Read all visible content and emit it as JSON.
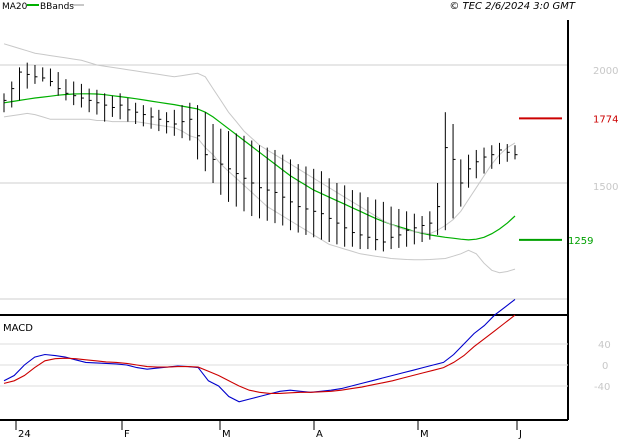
{
  "header": {
    "legend": [
      {
        "label": "MA20",
        "color": "#00b000"
      },
      {
        "label": "BBands",
        "color": "#c8c8c8"
      }
    ],
    "stamp": "© TEC 2/6/2024 3:0 GMT"
  },
  "chart_data": [
    {
      "type": "ohlc",
      "y_ticks": [
        "2000",
        "1500"
      ],
      "x_ticks": [
        "24",
        "F",
        "M",
        "A",
        "M",
        "J"
      ],
      "levels": [
        {
          "label": "1774",
          "value": 1774,
          "color": "#cc0000"
        },
        {
          "label": "1259",
          "value": 1259,
          "color": "#00a000"
        }
      ],
      "series": [
        {
          "name": "MA20",
          "color": "#00b000",
          "values": [
            1840,
            1845,
            1850,
            1855,
            1860,
            1864,
            1868,
            1872,
            1875,
            1877,
            1878,
            1878,
            1877,
            1874,
            1870,
            1866,
            1862,
            1857,
            1852,
            1847,
            1842,
            1837,
            1832,
            1826,
            1820,
            1814,
            1800,
            1780,
            1755,
            1730,
            1705,
            1680,
            1655,
            1630,
            1605,
            1580,
            1555,
            1530,
            1510,
            1490,
            1470,
            1455,
            1440,
            1425,
            1410,
            1395,
            1380,
            1365,
            1350,
            1337,
            1325,
            1315,
            1305,
            1295,
            1287,
            1280,
            1275,
            1270,
            1266,
            1262,
            1259,
            1262,
            1270,
            1285,
            1305,
            1330,
            1360
          ]
        },
        {
          "name": "BBands upper",
          "color": "#c8c8c8",
          "values": [
            2090,
            2080,
            2070,
            2060,
            2050,
            2045,
            2040,
            2035,
            2030,
            2025,
            2020,
            2010,
            2000,
            1995,
            1990,
            1985,
            1980,
            1975,
            1970,
            1965,
            1960,
            1955,
            1950,
            1955,
            1960,
            1965,
            1950,
            1900,
            1850,
            1800,
            1760,
            1720,
            1690,
            1660,
            1640,
            1620,
            1600,
            1580,
            1560,
            1540,
            1520,
            1500,
            1480,
            1460,
            1440,
            1420,
            1400,
            1380,
            1360,
            1340,
            1325,
            1310,
            1300,
            1295,
            1290,
            1285,
            1300,
            1320,
            1345,
            1380,
            1430,
            1480,
            1530,
            1580,
            1620,
            1650,
            1670
          ]
        },
        {
          "name": "BBands lower",
          "color": "#c8c8c8",
          "values": [
            1780,
            1785,
            1790,
            1795,
            1790,
            1780,
            1770,
            1770,
            1770,
            1770,
            1770,
            1770,
            1765,
            1765,
            1760,
            1760,
            1760,
            1760,
            1755,
            1750,
            1745,
            1740,
            1735,
            1720,
            1700,
            1690,
            1650,
            1620,
            1580,
            1550,
            1520,
            1490,
            1460,
            1430,
            1400,
            1380,
            1360,
            1340,
            1320,
            1300,
            1280,
            1260,
            1240,
            1230,
            1220,
            1210,
            1200,
            1195,
            1190,
            1185,
            1180,
            1178,
            1176,
            1175,
            1175,
            1176,
            1178,
            1180,
            1190,
            1200,
            1215,
            1200,
            1160,
            1130,
            1120,
            1125,
            1135
          ]
        }
      ],
      "candles": {
        "high": [
          1880,
          1930,
          1990,
          2010,
          2000,
          1990,
          1985,
          1970,
          1940,
          1930,
          1920,
          1900,
          1895,
          1880,
          1870,
          1880,
          1860,
          1840,
          1830,
          1820,
          1810,
          1800,
          1810,
          1830,
          1840,
          1830,
          1800,
          1750,
          1730,
          1720,
          1710,
          1700,
          1680,
          1660,
          1650,
          1640,
          1620,
          1600,
          1580,
          1570,
          1560,
          1550,
          1520,
          1500,
          1490,
          1470,
          1460,
          1440,
          1430,
          1420,
          1400,
          1390,
          1380,
          1370,
          1360,
          1380,
          1500,
          1800,
          1750,
          1600,
          1620,
          1640,
          1650,
          1660,
          1670,
          1665,
          1660
        ],
        "low": [
          1800,
          1820,
          1850,
          1900,
          1920,
          1930,
          1910,
          1870,
          1850,
          1830,
          1820,
          1800,
          1790,
          1760,
          1780,
          1770,
          1760,
          1750,
          1740,
          1730,
          1720,
          1710,
          1700,
          1690,
          1680,
          1600,
          1550,
          1500,
          1450,
          1420,
          1400,
          1380,
          1360,
          1350,
          1340,
          1330,
          1320,
          1300,
          1290,
          1280,
          1270,
          1260,
          1250,
          1240,
          1230,
          1230,
          1220,
          1220,
          1215,
          1210,
          1220,
          1225,
          1230,
          1240,
          1250,
          1260,
          1280,
          1300,
          1350,
          1400,
          1480,
          1520,
          1540,
          1560,
          1580,
          1590,
          1600
        ],
        "close": [
          1850,
          1900,
          1970,
          1960,
          1950,
          1945,
          1930,
          1900,
          1880,
          1870,
          1860,
          1850,
          1840,
          1830,
          1820,
          1830,
          1810,
          1800,
          1790,
          1780,
          1770,
          1760,
          1750,
          1760,
          1770,
          1700,
          1620,
          1600,
          1580,
          1560,
          1540,
          1520,
          1500,
          1480,
          1470,
          1460,
          1440,
          1420,
          1400,
          1390,
          1380,
          1370,
          1350,
          1330,
          1310,
          1290,
          1280,
          1270,
          1260,
          1250,
          1270,
          1280,
          1300,
          1310,
          1320,
          1330,
          1400,
          1650,
          1600,
          1500,
          1560,
          1590,
          1610,
          1620,
          1640,
          1630,
          1620
        ]
      }
    },
    {
      "type": "line",
      "title": "MACD",
      "y_ticks": [
        "40",
        "0",
        "-40"
      ],
      "series": [
        {
          "name": "MACD",
          "color": "#0000cc",
          "values": [
            -30,
            -20,
            0,
            15,
            20,
            18,
            15,
            10,
            5,
            4,
            3,
            2,
            0,
            -5,
            -8,
            -6,
            -4,
            -2,
            -3,
            -5,
            -30,
            -40,
            -60,
            -70,
            -65,
            -60,
            -55,
            -50,
            -48,
            -50,
            -52,
            -50,
            -48,
            -45,
            -40,
            -35,
            -30,
            -25,
            -20,
            -15,
            -10,
            -5,
            0,
            5,
            20,
            40,
            60,
            75,
            95,
            110,
            125
          ]
        },
        {
          "name": "Signal",
          "color": "#cc0000",
          "values": [
            -35,
            -30,
            -20,
            -5,
            8,
            12,
            13,
            12,
            10,
            8,
            6,
            5,
            3,
            0,
            -3,
            -4,
            -4,
            -3,
            -3,
            -4,
            -12,
            -20,
            -30,
            -40,
            -48,
            -52,
            -54,
            -54,
            -53,
            -52,
            -52,
            -51,
            -50,
            -48,
            -45,
            -42,
            -38,
            -34,
            -30,
            -25,
            -20,
            -15,
            -10,
            -5,
            5,
            18,
            35,
            50,
            65,
            80,
            95
          ]
        }
      ]
    }
  ]
}
